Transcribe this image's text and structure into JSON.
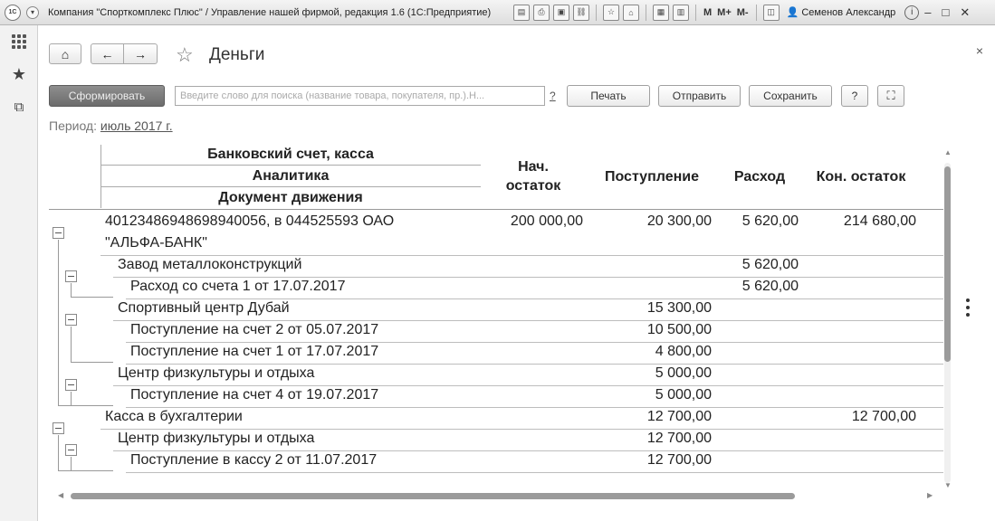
{
  "window": {
    "title": "Компания \"Спорткомплекс Плюс\" / Управление нашей фирмой, редакция 1.6  (1С:Предприятие)",
    "logo_text": "1С",
    "user": "Семенов Александр",
    "memory_buttons": [
      "M",
      "M+",
      "M-"
    ]
  },
  "toolbar": {
    "title": "Деньги",
    "generate_label": "Сформировать",
    "search_placeholder": "Введите слово для поиска (название товара, покупателя, пр.).Н...",
    "search_help": "?",
    "print_label": "Печать",
    "send_label": "Отправить",
    "save_label": "Сохранить",
    "help_label": "?"
  },
  "period": {
    "label": "Период:",
    "value": "июль 2017 г."
  },
  "report": {
    "headers": {
      "col1_line1": "Банковский счет, касса",
      "col1_line2": "Аналитика",
      "col1_line3": "Документ движения",
      "start_balance_l1": "Нач.",
      "start_balance_l2": "остаток",
      "income": "Поступление",
      "expense": "Расход",
      "end_balance": "Кон. остаток"
    },
    "rows": [
      {
        "level": 0,
        "name": "40123486948698940056, в 044525593 ОАО",
        "name2": "\"АЛЬФА-БАНК\"",
        "start": "200 000,00",
        "income": "20 300,00",
        "expense": "5 620,00",
        "end": "214 680,00"
      },
      {
        "level": 1,
        "name": "Завод металлоконструкций",
        "start": "",
        "income": "",
        "expense": "5 620,00",
        "end": ""
      },
      {
        "level": 2,
        "name": "Расход со счета 1 от 17.07.2017",
        "start": "",
        "income": "",
        "expense": "5 620,00",
        "end": ""
      },
      {
        "level": 1,
        "name": "Спортивный центр Дубай",
        "start": "",
        "income": "15 300,00",
        "expense": "",
        "end": ""
      },
      {
        "level": 2,
        "name": "Поступление на счет 2 от 05.07.2017",
        "start": "",
        "income": "10 500,00",
        "expense": "",
        "end": ""
      },
      {
        "level": 2,
        "name": "Поступление на счет 1 от 17.07.2017",
        "start": "",
        "income": "4 800,00",
        "expense": "",
        "end": ""
      },
      {
        "level": 1,
        "name": "Центр физкультуры и отдыха",
        "start": "",
        "income": "5 000,00",
        "expense": "",
        "end": ""
      },
      {
        "level": 2,
        "name": "Поступление на счет 4 от 19.07.2017",
        "start": "",
        "income": "5 000,00",
        "expense": "",
        "end": ""
      },
      {
        "level": 0,
        "name": "Касса в бухгалтерии",
        "start": "",
        "income": "12 700,00",
        "expense": "",
        "end": "12 700,00"
      },
      {
        "level": 1,
        "name": "Центр физкультуры и отдыха",
        "start": "",
        "income": "12 700,00",
        "expense": "",
        "end": ""
      },
      {
        "level": 2,
        "name": "Поступление в кассу 2 от 11.07.2017",
        "start": "",
        "income": "12 700,00",
        "expense": "",
        "end": ""
      }
    ]
  }
}
